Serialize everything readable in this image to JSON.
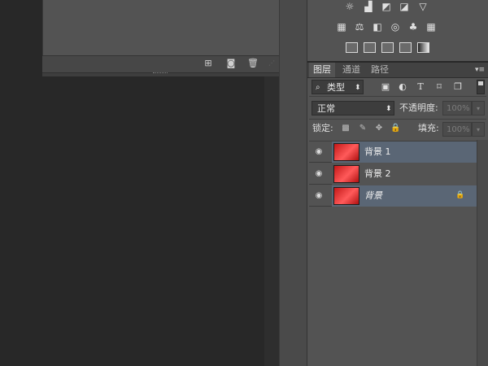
{
  "history_panel": {
    "footer_icons": [
      "new-document-from-state-icon",
      "camera-icon",
      "trash-icon"
    ]
  },
  "adjustments": {
    "row1_icons": [
      "brightness-icon",
      "levels-icon",
      "curves-icon",
      "exposure-icon",
      "triangle-icon"
    ],
    "row2_icons": [
      "vibrance-icon",
      "balance-icon",
      "black-white-icon",
      "photo-filter-icon",
      "channel-mixer-icon",
      "color-lookup-icon"
    ],
    "row3_icons": [
      "invert-icon",
      "posterize-icon",
      "threshold-icon",
      "selective-color-icon",
      "gradient-map-icon"
    ]
  },
  "tabs": [
    {
      "label": "图层",
      "active": true
    },
    {
      "label": "通道",
      "active": false
    },
    {
      "label": "路径",
      "active": false
    }
  ],
  "filter": {
    "kind_label": "类型",
    "kind_arrow": "⬍",
    "icons": [
      "pixel-filter-icon",
      "adjustment-filter-icon",
      "type-filter-icon",
      "shape-filter-icon",
      "smart-object-filter-icon"
    ],
    "toggle": "filter-toggle-icon"
  },
  "blend": {
    "mode": "正常",
    "opacity_label": "不透明度:",
    "opacity_value": "100%"
  },
  "lock": {
    "label": "锁定:",
    "icons": [
      "lock-transparent-icon",
      "lock-brush-icon",
      "lock-move-icon",
      "lock-all-icon"
    ],
    "fill_label": "填充:",
    "fill_value": "100%"
  },
  "layers": [
    {
      "name": "背景 1",
      "selected": true,
      "locked": false
    },
    {
      "name": "背景 2",
      "selected": false,
      "locked": false
    },
    {
      "name": "背景",
      "selected": true,
      "locked": true
    }
  ],
  "colors": {
    "selected_row": "#5a6675",
    "unselected_row": "#535353",
    "thumbnail": "#e02828"
  }
}
